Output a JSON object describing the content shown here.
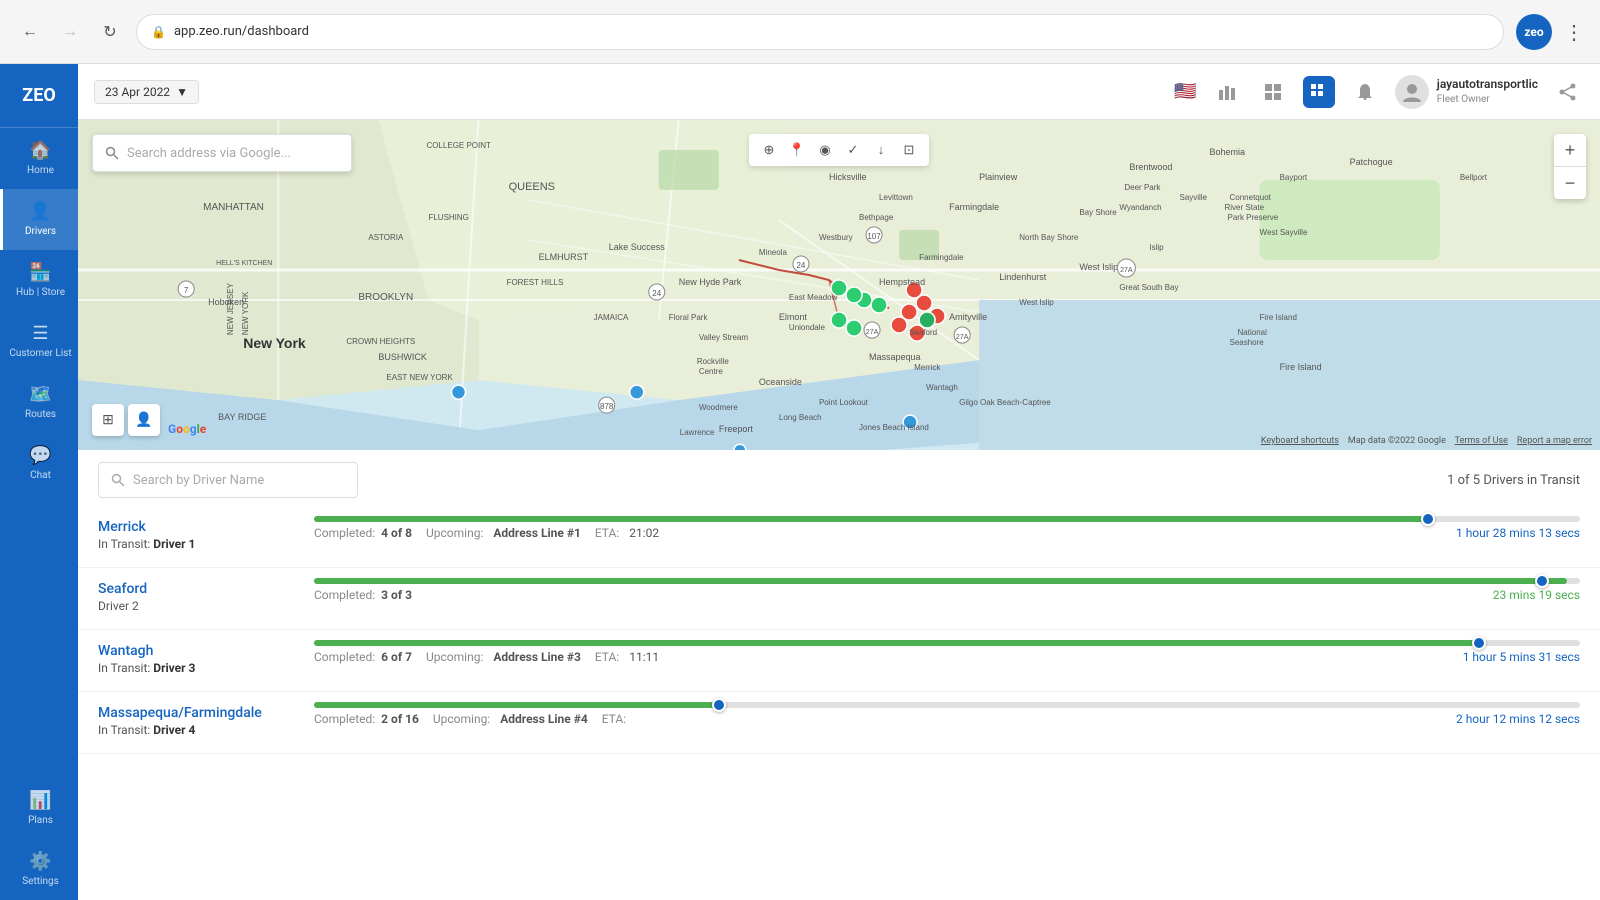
{
  "browser": {
    "address": "app.zeo.run/dashboard",
    "back_disabled": false,
    "forward_disabled": false,
    "zeo_avatar": "zeo"
  },
  "header": {
    "date": "23 Apr 2022",
    "date_icon": "📅",
    "user_name": "jayautotransportlic",
    "user_role": "Fleet Owner",
    "flag": "🇺🇸"
  },
  "sidebar": {
    "logo": "ZEO",
    "items": [
      {
        "id": "home",
        "label": "Home",
        "icon": "🏠",
        "active": false
      },
      {
        "id": "drivers",
        "label": "Drivers",
        "icon": "👤",
        "active": true
      },
      {
        "id": "hub-store",
        "label": "Hub | Store",
        "icon": "🏪",
        "active": false
      },
      {
        "id": "customer-list",
        "label": "Customer List",
        "icon": "📋",
        "active": false
      },
      {
        "id": "routes",
        "label": "Routes",
        "icon": "🗺️",
        "active": false
      },
      {
        "id": "chat",
        "label": "Chat",
        "icon": "💬",
        "active": false
      },
      {
        "id": "plans",
        "label": "Plans",
        "icon": "📊",
        "active": false
      },
      {
        "id": "settings",
        "label": "Settings",
        "icon": "⚙️",
        "active": false
      }
    ]
  },
  "map": {
    "search_placeholder": "Search address via Google...",
    "zoom_in": "+",
    "zoom_out": "−",
    "attribution": "Map data ©2022 Google  Terms of Use  Report a map error",
    "keyboard_shortcuts": "Keyboard shortcuts"
  },
  "driver_list": {
    "search_placeholder": "Search by Driver Name",
    "drivers_count_text": "1 of 5 Drivers in Transit",
    "drivers": [
      {
        "id": "merrick",
        "name": "Merrick",
        "status": "In Transit:",
        "driver_label": "Driver 1",
        "completed": "4 of 8",
        "upcoming_label": "Upcoming:",
        "upcoming_address": "Address Line #1",
        "eta_label": "ETA:",
        "eta_value": "21:02",
        "progress_pct": 88,
        "thumb_pct": 88,
        "time_remaining": "1 hour 28 mins 13 secs",
        "time_color": "#1565C0"
      },
      {
        "id": "seaford",
        "name": "Seaford",
        "status": "",
        "driver_label": "Driver 2",
        "completed": "3 of 3",
        "upcoming_label": "",
        "upcoming_address": "",
        "eta_label": "",
        "eta_value": "",
        "progress_pct": 99,
        "thumb_pct": 99,
        "time_remaining": "23 mins 19 secs",
        "time_color": "#4CAF50"
      },
      {
        "id": "wantagh",
        "name": "Wantagh",
        "status": "In Transit:",
        "driver_label": "Driver 3",
        "completed": "6 of 7",
        "upcoming_label": "Upcoming:",
        "upcoming_address": "Address Line #3",
        "eta_label": "ETA:",
        "eta_value": "11:11",
        "progress_pct": 92,
        "thumb_pct": 92,
        "time_remaining": "1 hour 5 mins 31 secs",
        "time_color": "#1565C0"
      },
      {
        "id": "massapequa",
        "name": "Massapequa/Farmingdale",
        "status": "In Transit:",
        "driver_label": "Driver 4",
        "completed": "2 of 16",
        "upcoming_label": "Upcoming:",
        "upcoming_address": "Address Line #4",
        "eta_label": "ETA:",
        "eta_value": "",
        "progress_pct": 32,
        "thumb_pct": 32,
        "time_remaining": "2 hour 12 mins 12 secs",
        "time_color": "#1565C0"
      }
    ]
  }
}
